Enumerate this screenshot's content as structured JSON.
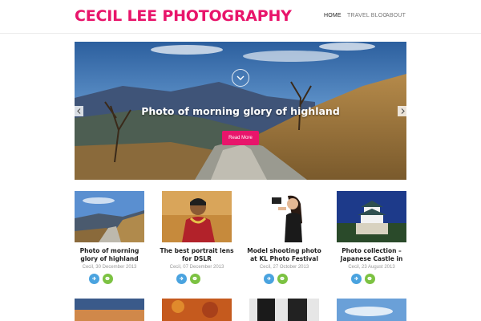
{
  "header": {
    "site_title": "CECIL LEE PHOTOGRAPHY",
    "nav": [
      {
        "label": "HOME",
        "active": true
      },
      {
        "label": "TRAVEL BLOG",
        "active": false
      },
      {
        "label": "ABOUT",
        "active": false
      }
    ]
  },
  "hero": {
    "title": "Photo of morning glory of highland",
    "button_label": "Read More",
    "icons": {
      "down": "chevron-down-icon",
      "prev": "chevron-left-icon",
      "next": "chevron-right-icon"
    }
  },
  "posts": [
    {
      "title": "Photo of morning glory of highland",
      "meta": "Cecil, 30 December 2013"
    },
    {
      "title": "The best portrait lens for DSLR",
      "meta": "Cecil, 07 December 2013"
    },
    {
      "title": "Model shooting photo at KL Photo Festival",
      "meta": "Cecil, 27 October 2013"
    },
    {
      "title": "Photo collection – Japanese Castle in",
      "meta": "Cecil, 23 August 2013"
    }
  ],
  "share_icons": [
    "share-icon",
    "wechat-icon"
  ],
  "colors": {
    "accent": "#e8156b",
    "share_blue": "#4aa3df",
    "share_green": "#7cc242"
  }
}
